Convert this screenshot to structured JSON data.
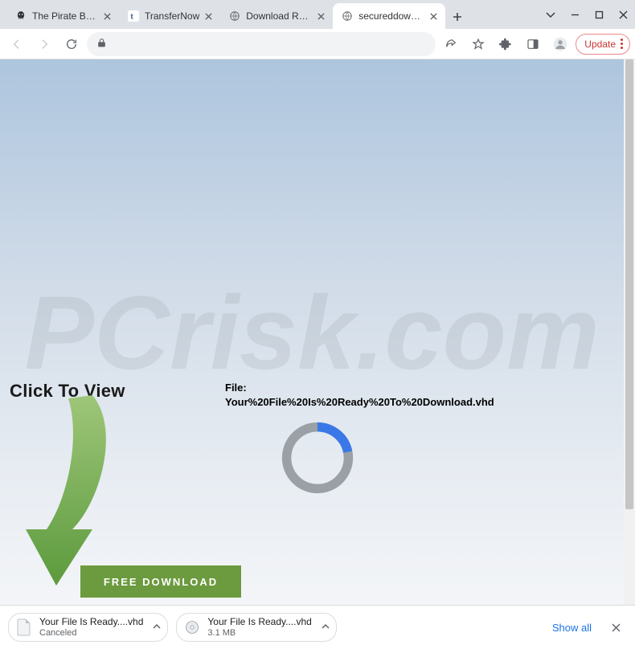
{
  "tabs": [
    {
      "label": "The Pirate Bay - T"
    },
    {
      "label": "TransferNow"
    },
    {
      "label": "Download Ready"
    },
    {
      "label": "secureddownload"
    }
  ],
  "toolbar": {
    "update_label": "Update"
  },
  "page": {
    "click_to_view": "Click To View",
    "file_label": "File:",
    "file_name": "Your%20File%20Is%20Ready%20To%20Download.vhd",
    "free_download": "FREE DOWNLOAD"
  },
  "downloads": [
    {
      "name": "Your File Is Ready....vhd",
      "sub": "Canceled"
    },
    {
      "name": "Your File Is Ready....vhd",
      "sub": "3.1 MB"
    }
  ],
  "dlbar": {
    "show_all": "Show all"
  }
}
